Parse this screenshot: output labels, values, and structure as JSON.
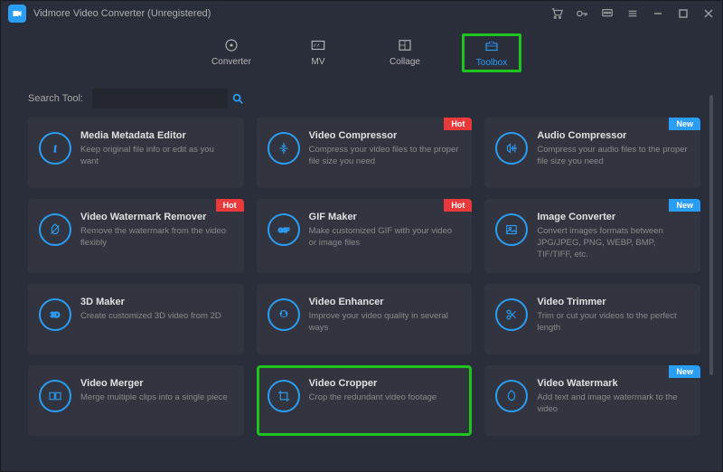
{
  "titlebar": {
    "title": "Vidmore Video Converter (Unregistered)"
  },
  "nav": {
    "converter": "Converter",
    "mv": "MV",
    "collage": "Collage",
    "toolbox": "Toolbox"
  },
  "search": {
    "label": "Search Tool:",
    "value": ""
  },
  "badges": {
    "hot": "Hot",
    "new": "New"
  },
  "tools": [
    {
      "title": "Media Metadata Editor",
      "desc": "Keep original file info or edit as you want",
      "badge": null,
      "icon": "info"
    },
    {
      "title": "Video Compressor",
      "desc": "Compress your video files to the proper file size you need",
      "badge": "hot",
      "icon": "compress"
    },
    {
      "title": "Audio Compressor",
      "desc": "Compress your audio files to the proper file size you need",
      "badge": "new",
      "icon": "audio-compress"
    },
    {
      "title": "Video Watermark Remover",
      "desc": "Remove the watermark from the video flexibly",
      "badge": "hot",
      "icon": "watermark-remove"
    },
    {
      "title": "GIF Maker",
      "desc": "Make customized GIF with your video or image files",
      "badge": "hot",
      "icon": "gif"
    },
    {
      "title": "Image Converter",
      "desc": "Convert images formats between JPG/JPEG, PNG, WEBP, BMP, TIF/TIFF, etc.",
      "badge": "new",
      "icon": "image"
    },
    {
      "title": "3D Maker",
      "desc": "Create customized 3D video from 2D",
      "badge": null,
      "icon": "3d"
    },
    {
      "title": "Video Enhancer",
      "desc": "Improve your video quality in several ways",
      "badge": null,
      "icon": "enhance"
    },
    {
      "title": "Video Trimmer",
      "desc": "Trim or cut your videos to the perfect length",
      "badge": null,
      "icon": "trim"
    },
    {
      "title": "Video Merger",
      "desc": "Merge multiple clips into a single piece",
      "badge": null,
      "icon": "merge"
    },
    {
      "title": "Video Cropper",
      "desc": "Crop the redundant video footage",
      "badge": null,
      "icon": "crop",
      "highlight": true
    },
    {
      "title": "Video Watermark",
      "desc": "Add text and image watermark to the video",
      "badge": "new",
      "icon": "watermark"
    }
  ]
}
